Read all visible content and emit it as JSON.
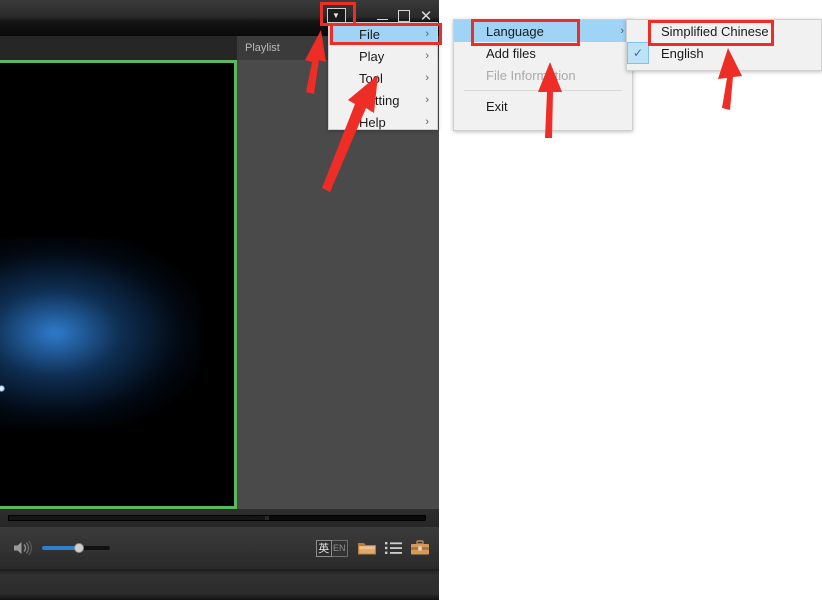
{
  "app": {
    "window_title": "",
    "titlebar_buttons": [
      {
        "name": "dropdown-menu-button",
        "glyph": "▼"
      },
      {
        "name": "minimize-button",
        "glyph": "–"
      },
      {
        "name": "maximize-button",
        "glyph": "□"
      },
      {
        "name": "close-button",
        "glyph": "✕"
      }
    ]
  },
  "tabs": {
    "video_label": "",
    "playlist_label": "Playlist"
  },
  "player": {
    "seek_percent": 62,
    "volume_percent": 55,
    "controls": [
      {
        "name": "language-toggle-icon",
        "label_cn": "英",
        "label_en": "EN"
      },
      {
        "name": "open-folder-icon",
        "label": ""
      },
      {
        "name": "playlist-icon",
        "label": ""
      },
      {
        "name": "toolbox-icon",
        "label": ""
      }
    ],
    "video_border_color": "#5cb85c",
    "glow_color": "#3282d7"
  },
  "menu1": {
    "items": [
      {
        "label": "File",
        "arrow": "›",
        "highlighted": true,
        "disabled": false
      },
      {
        "label": "Play",
        "arrow": "›",
        "highlighted": false,
        "disabled": false
      },
      {
        "label": "Tool",
        "arrow": "›",
        "highlighted": false,
        "disabled": false
      },
      {
        "label": "Setting",
        "arrow": "›",
        "highlighted": false,
        "disabled": false
      },
      {
        "label": "Help",
        "arrow": "›",
        "highlighted": false,
        "disabled": false
      }
    ]
  },
  "menu2": {
    "items": [
      {
        "label": "Language",
        "arrow": "›",
        "highlighted": true,
        "disabled": false
      },
      {
        "label": "Add files",
        "arrow": "",
        "highlighted": false,
        "disabled": false
      },
      {
        "label": "File Information",
        "arrow": "",
        "highlighted": false,
        "disabled": true
      },
      {
        "label": "Exit",
        "arrow": "",
        "highlighted": false,
        "disabled": false
      }
    ]
  },
  "menu3": {
    "items": [
      {
        "label": "Simplified Chinese",
        "checked": false
      },
      {
        "label": "English",
        "checked": true
      }
    ],
    "check_glyph": "✓"
  },
  "annotations": {
    "highlight_color": "#ee2d26",
    "boxes": [
      {
        "name": "dropdown-button-highlight"
      },
      {
        "name": "file-menu-highlight"
      },
      {
        "name": "language-menu-highlight"
      },
      {
        "name": "simplified-chinese-highlight"
      }
    ],
    "arrows": [
      {
        "name": "arrow-to-dropdown-button"
      },
      {
        "name": "arrow-to-tool-menu"
      },
      {
        "name": "arrow-to-add-files"
      },
      {
        "name": "arrow-to-english"
      }
    ]
  }
}
